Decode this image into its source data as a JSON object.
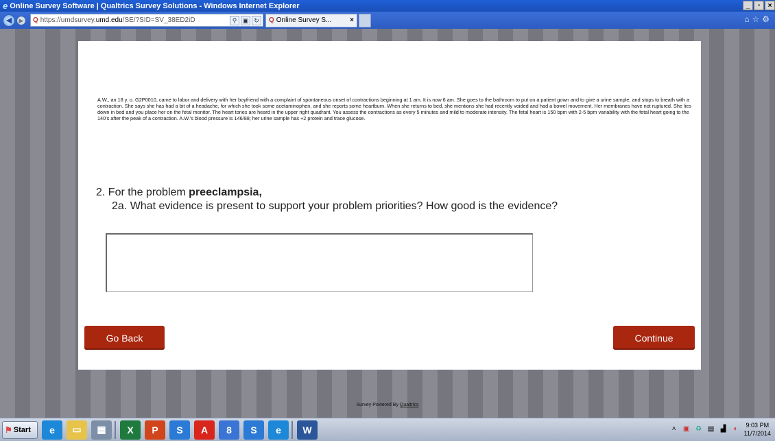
{
  "window": {
    "title": "Online Survey Software | Qualtrics Survey Solutions - Windows Internet Explorer"
  },
  "browser": {
    "address_prefix": "https://umdsurvey.",
    "address_domain": "umd.edu",
    "address_suffix": "/SE/?SID=SV_38ED2iD",
    "tab_label": "Online Survey S...",
    "tab_close": "×"
  },
  "survey": {
    "case_text": "A.W., an  18 y. o. G2P0010,  came to labor and delivery with her boyfriend with a complaint of spontaneous onset of contractions beginning at 1 am.  It is now 6 am.  She goes to the bathroom to put on a patient gown and to give a urine sample, and stops to breath with a contraction.  She says she has had a bit of a headache, for which she took some acetaminophen, and she reports some heartburn.  When she returns to bed, she mentions she had recently voided and had a bowel movement.  Her membranes have not ruptured.  She lies down in bed and you place her on the fetal monitor.  The heart tones are heard in the upper right quadrant. You assess the contractions as every 5 minutes and mild to moderate intensity.  The fetal heart is 150 bpm with 2-5 bpm variability with the fetal heart going to the 140's after the peak of a contraction.  A.W.'s blood pressure is 146/88; her urine sample has +2 protein and trace glucose.",
    "question_prefix": "2. For the problem ",
    "question_bold": "preeclampsia,",
    "question_sub": "2a. What evidence is present to support your problem priorities? How good is the evidence?",
    "answer_value": "",
    "back_label": "Go Back",
    "continue_label": "Continue",
    "footer_prefix": "Survey Powered By ",
    "footer_link": "Qualtrics"
  },
  "taskbar": {
    "start_label": "Start",
    "time": "9:03 PM",
    "date": "11/7/2014",
    "apps": [
      {
        "name": "ie",
        "glyph": "e",
        "color": "#1e88d8"
      },
      {
        "name": "explorer",
        "glyph": "▭",
        "color": "#e7c34a"
      },
      {
        "name": "calculator",
        "glyph": "▦",
        "color": "#7d8fa6"
      },
      {
        "name": "excel",
        "glyph": "X",
        "color": "#1f7a3e"
      },
      {
        "name": "powerpoint",
        "glyph": "P",
        "color": "#d0451b"
      },
      {
        "name": "app-blue",
        "glyph": "S",
        "color": "#2b7bd6"
      },
      {
        "name": "acrobat",
        "glyph": "A",
        "color": "#d9261c"
      },
      {
        "name": "app-8",
        "glyph": "8",
        "color": "#3a74d4"
      },
      {
        "name": "app-blue-2",
        "glyph": "S",
        "color": "#2b7bd6"
      },
      {
        "name": "ie-2",
        "glyph": "e",
        "color": "#1e88d8"
      },
      {
        "name": "word",
        "glyph": "W",
        "color": "#2b579a"
      }
    ]
  }
}
